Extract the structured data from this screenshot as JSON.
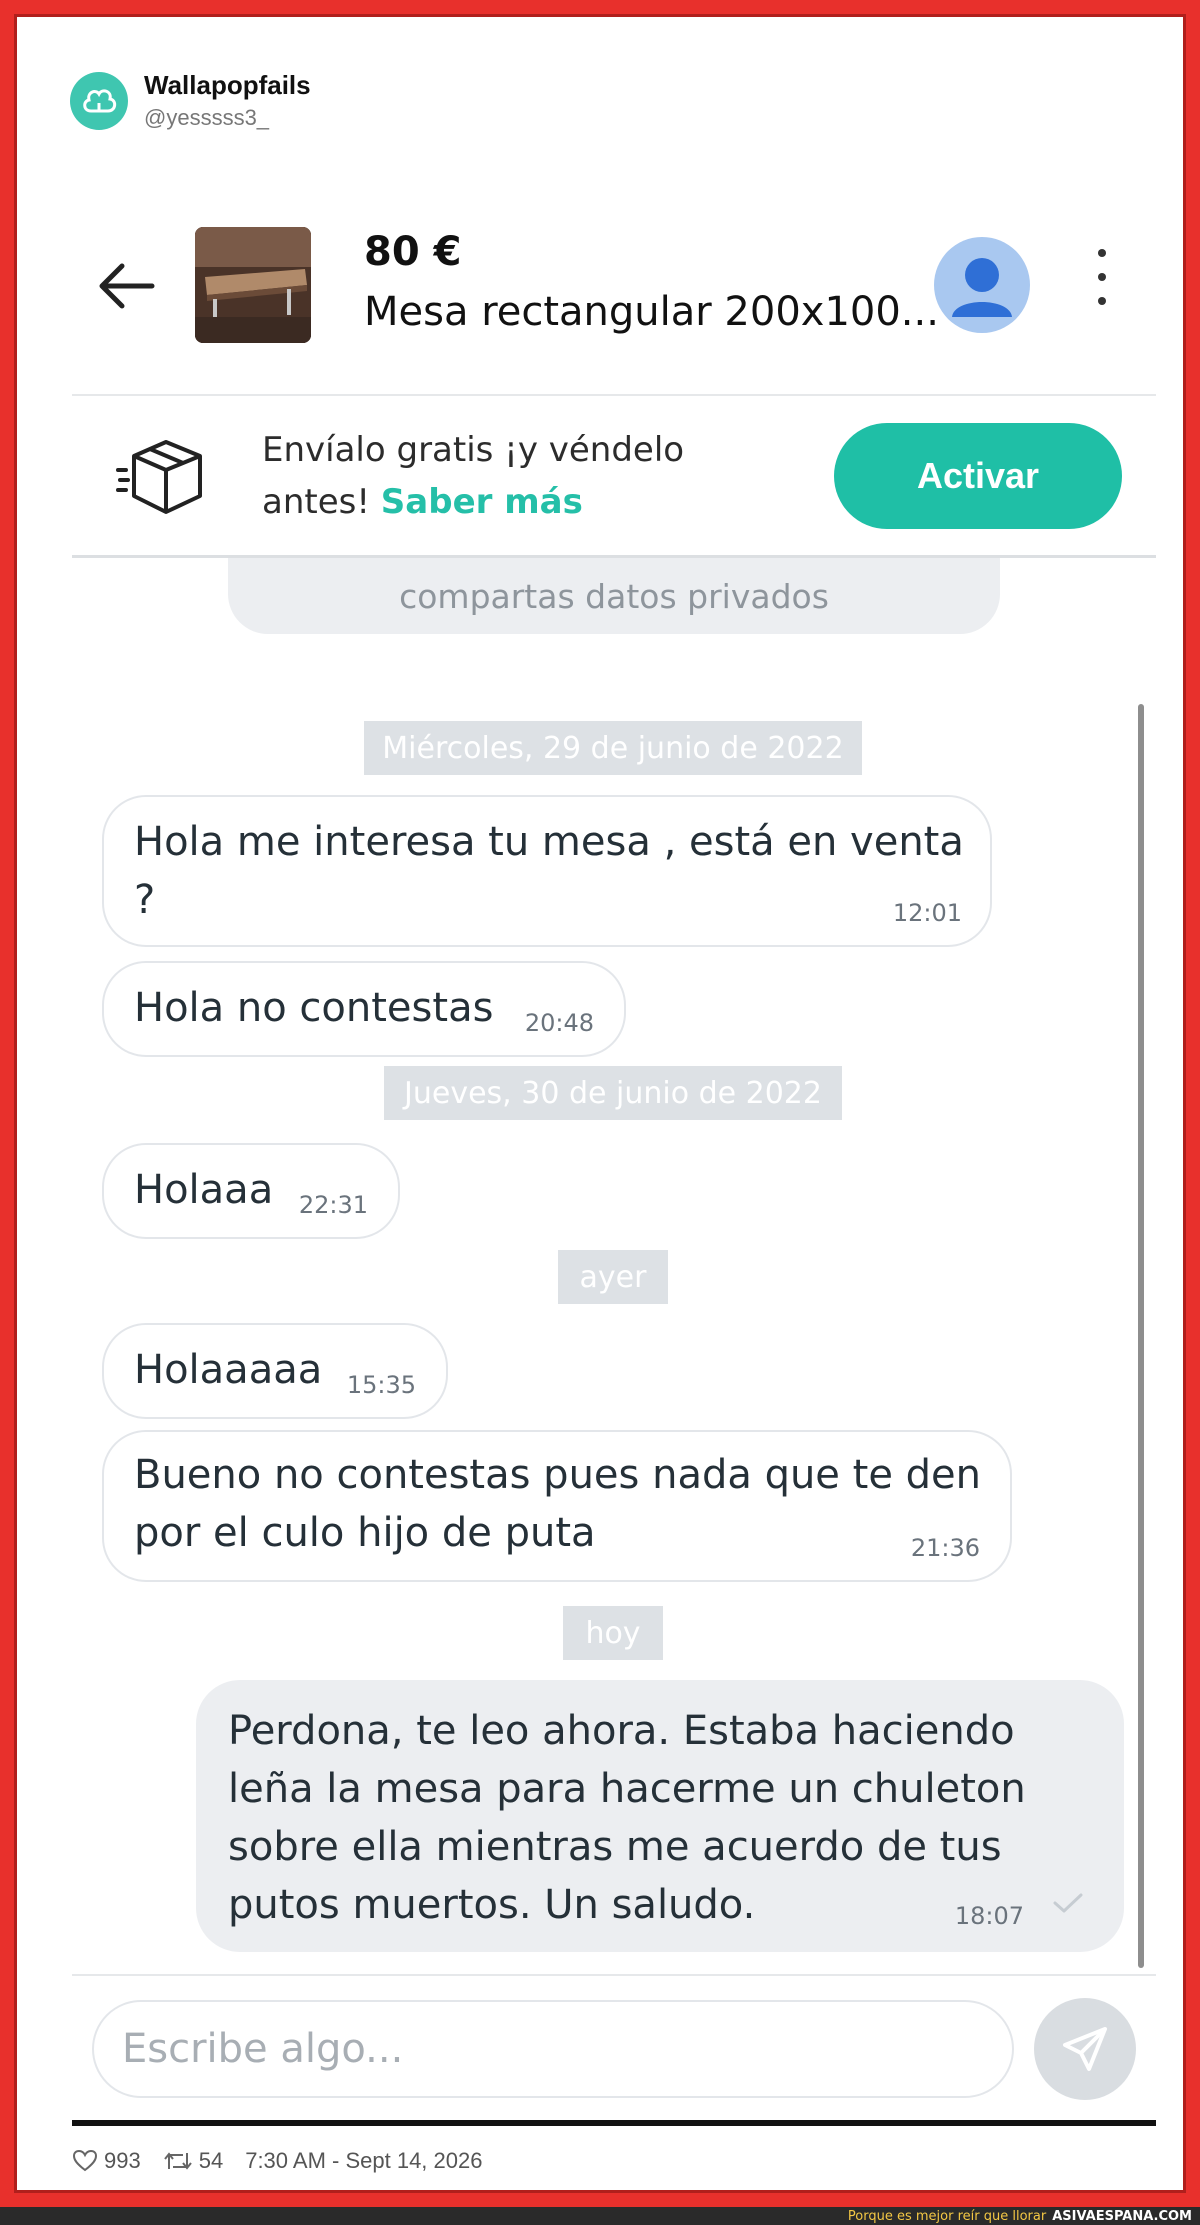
{
  "tweet": {
    "name": "Wallapopfails",
    "handle": "@yesssss3_",
    "likes": "993",
    "retweets": "54",
    "timestamp": "7:30 AM - Sept 14, 2026"
  },
  "listing": {
    "price": "80 €",
    "title": "Mesa rectangular 200x100..."
  },
  "promo": {
    "text": "Envíalo gratis ¡y véndelo antes!",
    "link": "Saber más",
    "button": "Activar"
  },
  "safety_notice": "compartas datos privados",
  "chat": {
    "items": [
      {
        "type": "date",
        "text": "Miércoles, 29 de junio de 2022"
      },
      {
        "type": "in",
        "text": "Hola me interesa tu mesa , está en venta ?",
        "time": "12:01"
      },
      {
        "type": "in",
        "text": "Hola no contestas",
        "time": "20:48"
      },
      {
        "type": "date",
        "text": "Jueves, 30 de junio de 2022"
      },
      {
        "type": "in",
        "text": "Holaaa",
        "time": "22:31"
      },
      {
        "type": "date",
        "text": "ayer"
      },
      {
        "type": "in",
        "text": "Holaaaaa",
        "time": "15:35"
      },
      {
        "type": "in",
        "text": "Bueno no contestas pues nada que te den por el culo hijo de puta",
        "time": "21:36"
      },
      {
        "type": "date",
        "text": "hoy"
      },
      {
        "type": "out",
        "text": "Perdona, te leo ahora. Estaba haciendo leña la mesa para hacerme un chuleton sobre ella mientras me acuerdo de tus putos muertos. Un saludo.",
        "time": "18:07"
      }
    ]
  },
  "composer": {
    "placeholder": "Escribe algo..."
  },
  "watermark": {
    "tagline": "Porque es mejor reír que llorar",
    "site": "ASIVAESPANA.COM"
  },
  "colors": {
    "frame": "#e8302c",
    "accent": "#1fbfa6",
    "bubble_in": "#ffffff",
    "bubble_out": "#eceef1",
    "date_chip": "#dde1e5"
  },
  "icons": [
    "wallapop-logo-icon",
    "back-arrow-icon",
    "user-avatar-icon",
    "more-vertical-icon",
    "shipping-box-icon",
    "send-icon",
    "check-icon",
    "heart-icon",
    "retweet-icon"
  ]
}
